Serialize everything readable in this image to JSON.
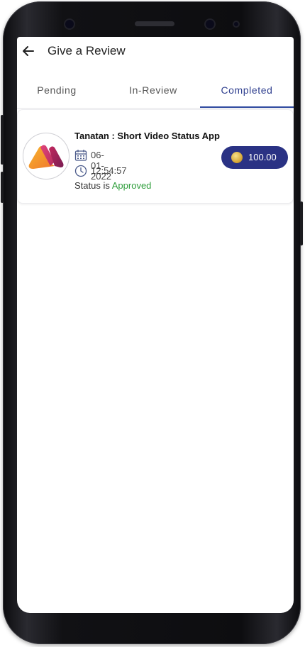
{
  "header": {
    "title": "Give a Review"
  },
  "tabs": [
    {
      "label": "Pending",
      "active": false
    },
    {
      "label": "In-Review",
      "active": false
    },
    {
      "label": "Completed",
      "active": true
    }
  ],
  "reviews": [
    {
      "app_name": "Tanatan : Short Video Status App",
      "date": "06-01-2022",
      "time": "12:54:57",
      "status_prefix": "Status is",
      "status_value": "Approved",
      "reward": "100.00"
    }
  ],
  "colors": {
    "accent": "#2a3284",
    "approved": "#2e9e3b",
    "active_tab": "#2f4aa0"
  },
  "icons": [
    "back-arrow-icon",
    "calendar-icon",
    "clock-icon",
    "coin-icon"
  ]
}
